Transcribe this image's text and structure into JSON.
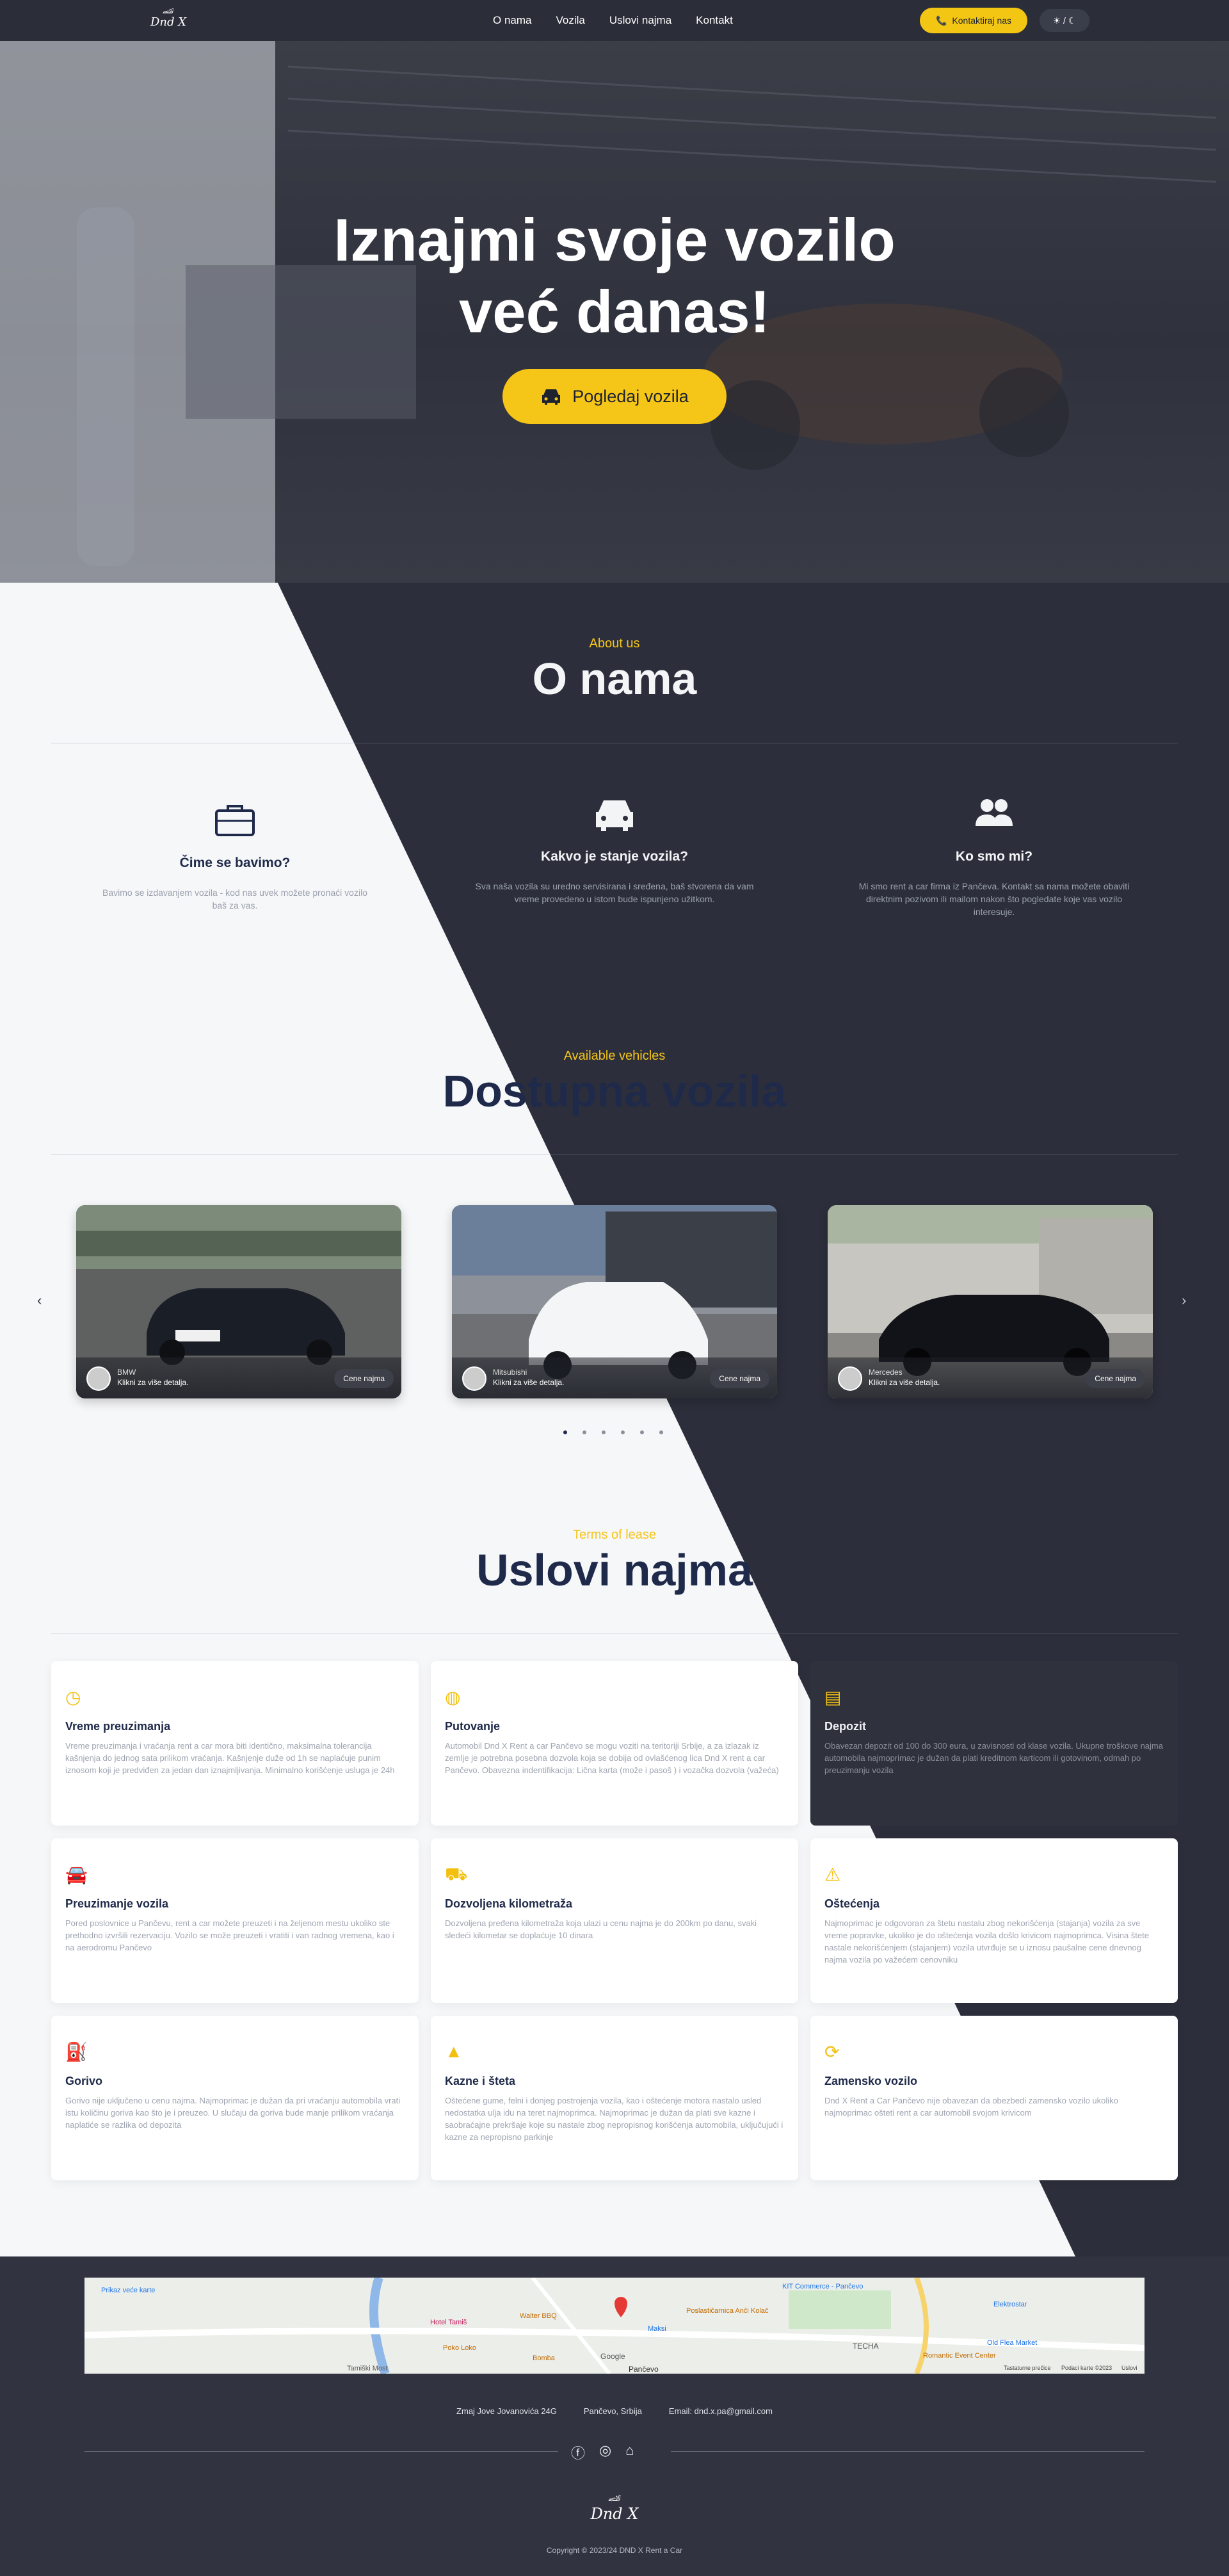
{
  "nav": {
    "logo_text": "Dnd X",
    "links": [
      "O nama",
      "Vozila",
      "Uslovi najma",
      "Kontakt"
    ],
    "cta_label": "Kontaktiraj nas",
    "theme_toggle": "☀ / ☾"
  },
  "hero": {
    "title_line1": "Iznajmi svoje vozilo",
    "title_line2": "već danas!",
    "button_label": "Pogledaj vozila"
  },
  "about": {
    "subtitle": "About us",
    "title": "O nama",
    "items": [
      {
        "icon": "briefcase-icon",
        "title": "Čime se bavimo?",
        "text": "Bavimo se izdavanjem vozila - kod nas uvek možete pronaći vozilo baš za vas."
      },
      {
        "icon": "car-icon",
        "title": "Kakvo je stanje vozila?",
        "text": "Sva naša vozila su uredno servisirana i sređena, baš stvorena da vam vreme provedeno u istom bude ispunjeno užitkom."
      },
      {
        "icon": "users-icon",
        "title": "Ko smo mi?",
        "text": "Mi smo rent a car firma iz Pančeva. Kontakt sa nama možete obaviti direktnim pozivom ili mailom nakon što pogledate koje vas vozilo interesuje."
      }
    ]
  },
  "vehicles": {
    "subtitle": "Available vehicles",
    "title": "Dostupna vozila",
    "cards": [
      {
        "brand": "BMW",
        "hint": "Klikni za više detalja.",
        "price_label": "Cene najma"
      },
      {
        "brand": "Mitsubishi",
        "hint": "Klikni za više detalja.",
        "price_label": "Cene najma"
      },
      {
        "brand": "Mercedes",
        "hint": "Klikni za više detalja.",
        "price_label": "Cene najma"
      }
    ],
    "dots_count": 6,
    "active_dot": 0
  },
  "terms": {
    "subtitle": "Terms of lease",
    "title": "Uslovi najma",
    "items": [
      {
        "icon": "clock-icon",
        "title": "Vreme preuzimanja",
        "text": "Vreme preuzimanja i vraćanja rent a car mora biti identično, maksimalna tolerancija kašnjenja do jednog sata prilikom vraćanja. Kašnjenje duže od 1h se naplaćuje punim iznosom koji je predviđen za jedan dan iznajmljivanja. Minimalno korišćenje usluga je 24h"
      },
      {
        "icon": "globe-icon",
        "title": "Putovanje",
        "text": "Automobil Dnd X Rent a car Pančevo se mogu voziti na teritoriji Srbije, a za izlazak iz zemlje je potrebna posebna dozvola koja se dobija od ovlašćenog lica Dnd X rent a car Pančevo. Obavezna indentifikacija: Lična karta (može i pasoš ) i vozačka dozvola (važeća)"
      },
      {
        "icon": "money-icon",
        "title": "Depozit",
        "text": "Obavezan depozit od 100 do 300 eura, u zavisnosti od klase vozila. Ukupne troškove najma automobila najmoprimac je dužan da plati kreditnom karticom ili gotovinom, odmah po preuzimanju vozila"
      },
      {
        "icon": "car-icon",
        "title": "Preuzimanje vozila",
        "text": "Pored poslovnice u Pančevu, rent a car možete preuzeti i na željenom mestu ukoliko ste prethodno izvršili rezervaciju. Vozilo se može preuzeti i vratiti i van radnog vremena, kao i na aerodromu Pančevo"
      },
      {
        "icon": "road-check-icon",
        "title": "Dozvoljena kilometraža",
        "text": "Dozvoljena pređena kilometraža koja ulazi u cenu najma je do 200km po danu, svaki sledeći kilometar se doplaćuje 10 dinara"
      },
      {
        "icon": "car-crash-icon",
        "title": "Oštećenja",
        "text": "Najmoprimac je odgovoran za štetu nastalu zbog nekorišćenja (stajanja) vozila za sve vreme popravke, ukoliko je do oštećenja vozila došlo krivicom najmoprimca. Visina štete nastale nekorišćenjem (stajanjem) vozila utvrđuje se u iznosu paušalne cene dnevnog najma vozila po važećem cenovniku"
      },
      {
        "icon": "fuel-icon",
        "title": "Gorivo",
        "text": "Gorivo nije uključeno u cenu najma. Najmoprimac je dužan da pri vraćanju automobila vrati istu količinu goriva kao što je i preuzeo. U slučaju da goriva bude manje prilikom vraćanja naplatiće se razlika od depozita"
      },
      {
        "icon": "warning-icon",
        "title": "Kazne i šteta",
        "text": "Oštećene gume, felni i donjeg postrojenja vozila, kao i oštećenje motora nastalo usled nedostatka ulja idu na teret najmoprimca. Najmoprimac je dužan da plati sve kazne i saobraćajne prekršaje koje su nastale zbog nepropisnog korišćenja automobila, uključujući i kazne za nepropisno parkinje"
      },
      {
        "icon": "refresh-icon",
        "title": "Zamensko vozilo",
        "text": "Dnd X Rent a Car Pančevo nije obavezan da obezbedi zamensko vozilo ukoliko najmoprimac ošteti rent a car automobil svojom krivicom"
      }
    ]
  },
  "map": {
    "labels": [
      "Prikaz veće karte",
      "KIT Commerce - Pančevo",
      "Walter BBQ",
      "Hotel Tamiš",
      "Maksi",
      "Poslastičarnica Anči Kolač",
      "Elektrostar",
      "Poko Loko",
      "Bomba",
      "Old Flea Market",
      "Romantic Event Center",
      "Tamiški Most",
      "Pančevo",
      "TECHA",
      "Google",
      "Tastaturne prečice",
      "Podaci karte ©2023",
      "Uslovi"
    ]
  },
  "footer": {
    "address": "Zmaj Jove Jovanovića 24G",
    "city": "Pančevo, Srbija",
    "email": "Email: dnd.x.pa@gmail.com",
    "logo_text": "Dnd X",
    "copyright": "Copyright © 2023/24 DND X Rent a Car"
  },
  "colors": {
    "accent": "#f5c518",
    "dark": "#2c2f3b",
    "navy": "#1f2a4a"
  }
}
